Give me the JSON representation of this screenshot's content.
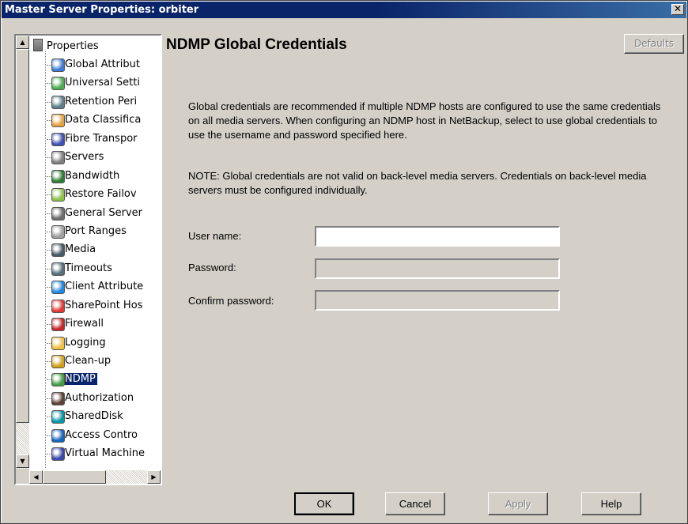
{
  "window": {
    "title": "Master Server Properties: orbiter",
    "close_glyph": "✕"
  },
  "tree": {
    "root_label": "Properties",
    "items": [
      {
        "label": "Global Attribut",
        "icon": "globe-icon",
        "color": "#3a7bd5"
      },
      {
        "label": "Universal Setti",
        "icon": "network-icon",
        "color": "#4caf50"
      },
      {
        "label": "Retention Peri",
        "icon": "clock-icon",
        "color": "#607d8b"
      },
      {
        "label": "Data Classifica",
        "icon": "classification-icon",
        "color": "#e6a23c"
      },
      {
        "label": "Fibre Transpor",
        "icon": "monitor-icon",
        "color": "#3f51b5"
      },
      {
        "label": "Servers",
        "icon": "server-icon",
        "color": "#7f7f7f"
      },
      {
        "label": "Bandwidth",
        "icon": "bandwidth-icon",
        "color": "#2e7d32"
      },
      {
        "label": "Restore Failov",
        "icon": "failover-icon",
        "color": "#8bc34a"
      },
      {
        "label": "General Server",
        "icon": "server-icon",
        "color": "#6d6d6d"
      },
      {
        "label": "Port Ranges",
        "icon": "port-icon",
        "color": "#9e9e9e"
      },
      {
        "label": "Media",
        "icon": "media-icon",
        "color": "#455a64"
      },
      {
        "label": "Timeouts",
        "icon": "timer-icon",
        "color": "#546e7a"
      },
      {
        "label": "Client Attribute",
        "icon": "client-icon",
        "color": "#1e88e5"
      },
      {
        "label": "SharePoint Hos",
        "icon": "sharepoint-icon",
        "color": "#e53935"
      },
      {
        "label": "Firewall",
        "icon": "firewall-icon",
        "color": "#c62828"
      },
      {
        "label": "Logging",
        "icon": "log-icon",
        "color": "#f0c040"
      },
      {
        "label": "Clean-up",
        "icon": "cleanup-icon",
        "color": "#d4a017"
      },
      {
        "label": "NDMP",
        "icon": "ndmp-icon",
        "color": "#43a047",
        "selected": true
      },
      {
        "label": "Authorization",
        "icon": "user-icon",
        "color": "#5d4037"
      },
      {
        "label": "SharedDisk",
        "icon": "disk-icon",
        "color": "#0097a7"
      },
      {
        "label": "Access Contro",
        "icon": "access-icon",
        "color": "#1565c0"
      },
      {
        "label": "Virtual Machine",
        "icon": "vm-icon",
        "color": "#3949ab"
      }
    ]
  },
  "panel": {
    "heading": "NDMP Global Credentials",
    "defaults_button": "Defaults",
    "description": "Global credentials are recommended if multiple NDMP hosts are configured to use the same credentials on all media servers. When configuring an NDMP host in NetBackup, select to use global credentials to use the username and password specified here.",
    "note": "NOTE: Global credentials are not valid on back-level media servers. Credentials on back-level media servers must be configured individually.",
    "fields": {
      "username_label": "User name:",
      "username_value": "",
      "password_label": "Password:",
      "password_value": "",
      "confirm_label": "Confirm password:",
      "confirm_value": ""
    }
  },
  "buttons": {
    "ok": "OK",
    "cancel": "Cancel",
    "apply": "Apply",
    "help": "Help"
  },
  "scroll": {
    "up": "▲",
    "down": "▼",
    "left": "◀",
    "right": "▶"
  }
}
